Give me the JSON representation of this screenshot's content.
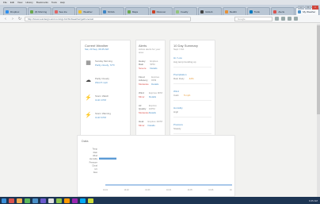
{
  "menu": [
    "File",
    "Edit",
    "View",
    "History",
    "Bookmarks",
    "Tools",
    "Help"
  ],
  "tabs": [
    {
      "label": "Dropbox",
      "color": "#2d8ff0"
    },
    {
      "label": "(3) Morning",
      "color": "#6aa84f"
    },
    {
      "label": "Sea Ice",
      "color": "#e06666"
    },
    {
      "label": "Weather",
      "color": "#f1c232"
    },
    {
      "label": "NOAA",
      "color": "#3d85c6"
    },
    {
      "label": "Maps",
      "color": "#6aa84f"
    },
    {
      "label": "Discover",
      "color": "#cc4125"
    },
    {
      "label": "Feedly",
      "color": "#93c47d"
    },
    {
      "label": "GitHub",
      "color": "#444444"
    },
    {
      "label": "Reddit",
      "color": "#e69138"
    },
    {
      "label": "Trello",
      "color": "#0079bf"
    },
    {
      "label": "Alerts",
      "color": "#d9534f"
    },
    {
      "label": "My Weather",
      "color": "#4a90c8"
    }
  ],
  "address": {
    "url": "http://www.wunderground.com/cgi-bin/findweather/getForecast",
    "search_placeholder": "Google"
  },
  "weather": {
    "title": "Current Weather",
    "subtitle": "Sat, 20 Sep, 09:45 AM",
    "rows": [
      {
        "icon": "calendar-icon",
        "line1": "Sunday Morning",
        "line2": "Partly cloudy, 72°F"
      },
      {
        "icon": "cloud-icon",
        "line1": "Partly Cloudy",
        "line2": "Wind 5 mph"
      },
      {
        "icon": "lightning-icon",
        "line1": "Storm Watch",
        "line2": "Until 4 PM"
      },
      {
        "icon": "lightning-icon",
        "line1": "Storm Warning",
        "line2": "Until 6 PM"
      }
    ]
  },
  "alerts": {
    "title": "Alerts",
    "subtitle": "Active alerts for your area",
    "rows": [
      {
        "name": "Heavy Rain",
        "status": "Expires 5PM",
        "meta": "Severe",
        "detail": "Details"
      },
      {
        "name": "Flood Advisory",
        "status": "Expires 8PM",
        "meta": "Moderate",
        "detail": "Details"
      },
      {
        "name": "Wind",
        "status": "Expires 9PM",
        "meta": "Minor",
        "detail": "Details"
      },
      {
        "name": "Air Quality",
        "status": "Expires 10PM",
        "meta": "Moderate",
        "detail": "Details"
      },
      {
        "name": "Heat",
        "status": "Expires 11PM",
        "meta": "Minor",
        "detail": "Details"
      }
    ]
  },
  "summary": {
    "title": "10 Day Summary",
    "subtitle": "Sept / Oct",
    "items": [
      {
        "label": "Hi / Low",
        "value": "Avg temp trending up"
      },
      {
        "label": "Precipitation",
        "value": "Rain likely",
        "extra": "42%"
      },
      {
        "label": "Wind",
        "value": "Calm",
        "extra": "5 mph"
      },
      {
        "label": "Humidity",
        "value": "High"
      },
      {
        "label": "Pressure",
        "value": "Steady"
      }
    ]
  },
  "chart": {
    "title": "Data",
    "ticks_x": [
      "10-01",
      "10-02",
      "10-03",
      "10-04",
      "10-05",
      "10-06",
      "10-07"
    ]
  },
  "chart_data": {
    "type": "bar",
    "title": "Data",
    "categories": [
      "Temp",
      "Rain",
      "Wind",
      "Humidity",
      "Pressure",
      "Cloud",
      "UV",
      "Dew"
    ],
    "values": [
      0,
      0,
      0,
      1,
      0,
      0,
      0,
      0
    ]
  },
  "taskbar": {
    "icons": [
      "#d9534f",
      "#f0ad4e",
      "#5cb85c",
      "#4a90c8",
      "#6a5acd",
      "#e0e0e0",
      "#8bc34a",
      "#ff9800",
      "#9c27b0",
      "#03a9f4",
      "#cddc39"
    ],
    "clock": "9:45 AM"
  }
}
